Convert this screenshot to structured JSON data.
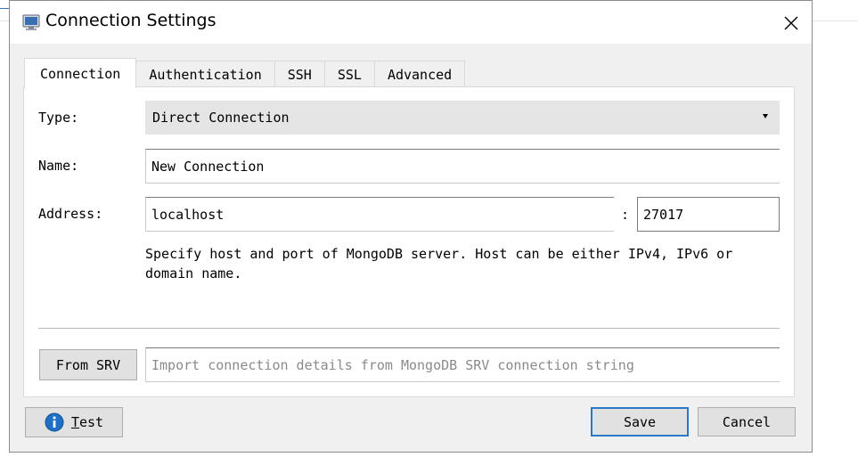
{
  "window": {
    "title": "Connection Settings"
  },
  "tabs": [
    {
      "label": "Connection",
      "active": true
    },
    {
      "label": "Authentication",
      "active": false
    },
    {
      "label": "SSH",
      "active": false
    },
    {
      "label": "SSL",
      "active": false
    },
    {
      "label": "Advanced",
      "active": false
    }
  ],
  "form": {
    "type_label": "Type:",
    "type_value": "Direct Connection",
    "name_label": "Name:",
    "name_value": "New Connection",
    "address_label": "Address:",
    "host_value": "localhost",
    "separator": ":",
    "port_value": "27017",
    "hint": "Specify host and port of MongoDB server. Host can be either IPv4, IPv6 or domain name.",
    "srv_button": "From SRV",
    "srv_placeholder": "Import connection details from MongoDB SRV connection string"
  },
  "footer": {
    "test_prefix": "T",
    "test_rest": "est",
    "save_label": "Save",
    "cancel_label": "Cancel"
  },
  "colors": {
    "dialog_bg": "#f0f0f0",
    "primary_border": "#2a78c8",
    "info_icon": "#1f6fc4"
  }
}
